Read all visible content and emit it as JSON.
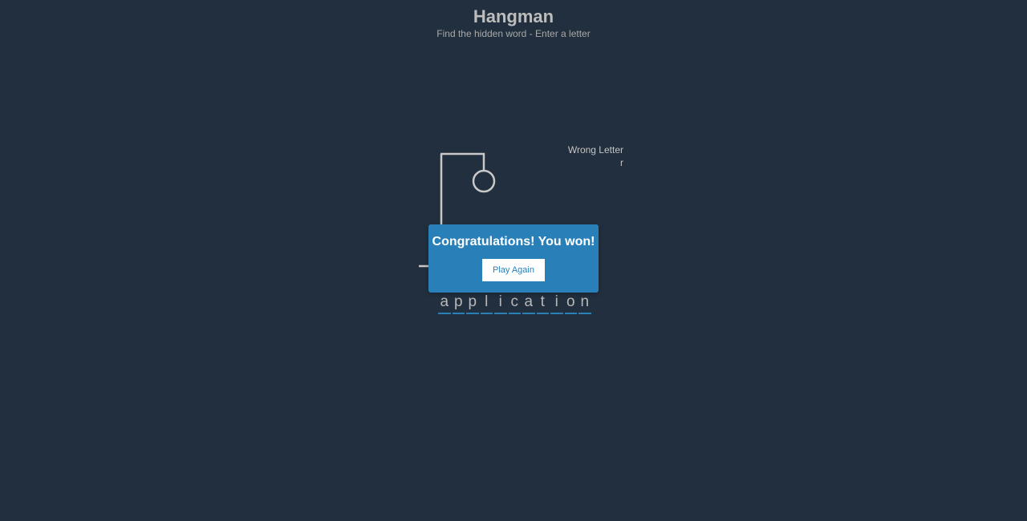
{
  "header": {
    "title": "Hangman",
    "subtitle": "Find the hidden word - Enter a letter"
  },
  "wrong_letters": {
    "label": "Wrong Letter",
    "letters": "r"
  },
  "word": {
    "letters": [
      "a",
      "p",
      "p",
      "l",
      "i",
      "c",
      "a",
      "t",
      "i",
      "o",
      "n"
    ]
  },
  "popup": {
    "message": "Congratulations! You won!",
    "button_label": "Play Again"
  },
  "colors": {
    "background": "#222f3e",
    "accent": "#2980b9",
    "figure": "#c8c8c8"
  }
}
